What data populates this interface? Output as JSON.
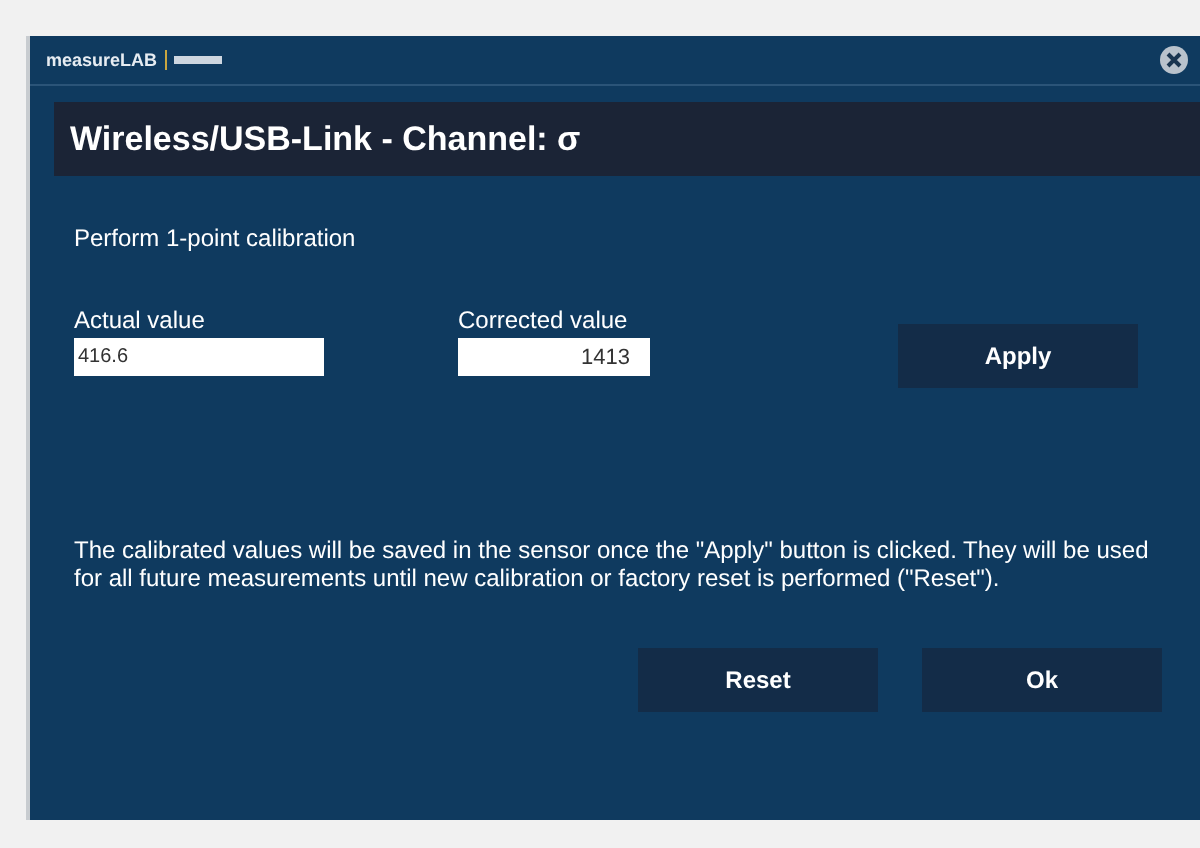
{
  "window": {
    "app_name": "measureLAB"
  },
  "title": "Wireless/USB-Link - Channel: σ",
  "section_label": "Perform 1-point calibration",
  "fields": [
    {
      "label": "Actual value",
      "value": "416.6"
    },
    {
      "label": "Corrected value",
      "value": "1413"
    }
  ],
  "apply_button": "Apply",
  "note": "The calibrated values will be saved in the sensor once the \"Apply\" button is clicked. They will be used for all future measurements until new calibration or factory reset is performed (\"Reset\").",
  "buttons": [
    "Reset",
    "Ok"
  ]
}
